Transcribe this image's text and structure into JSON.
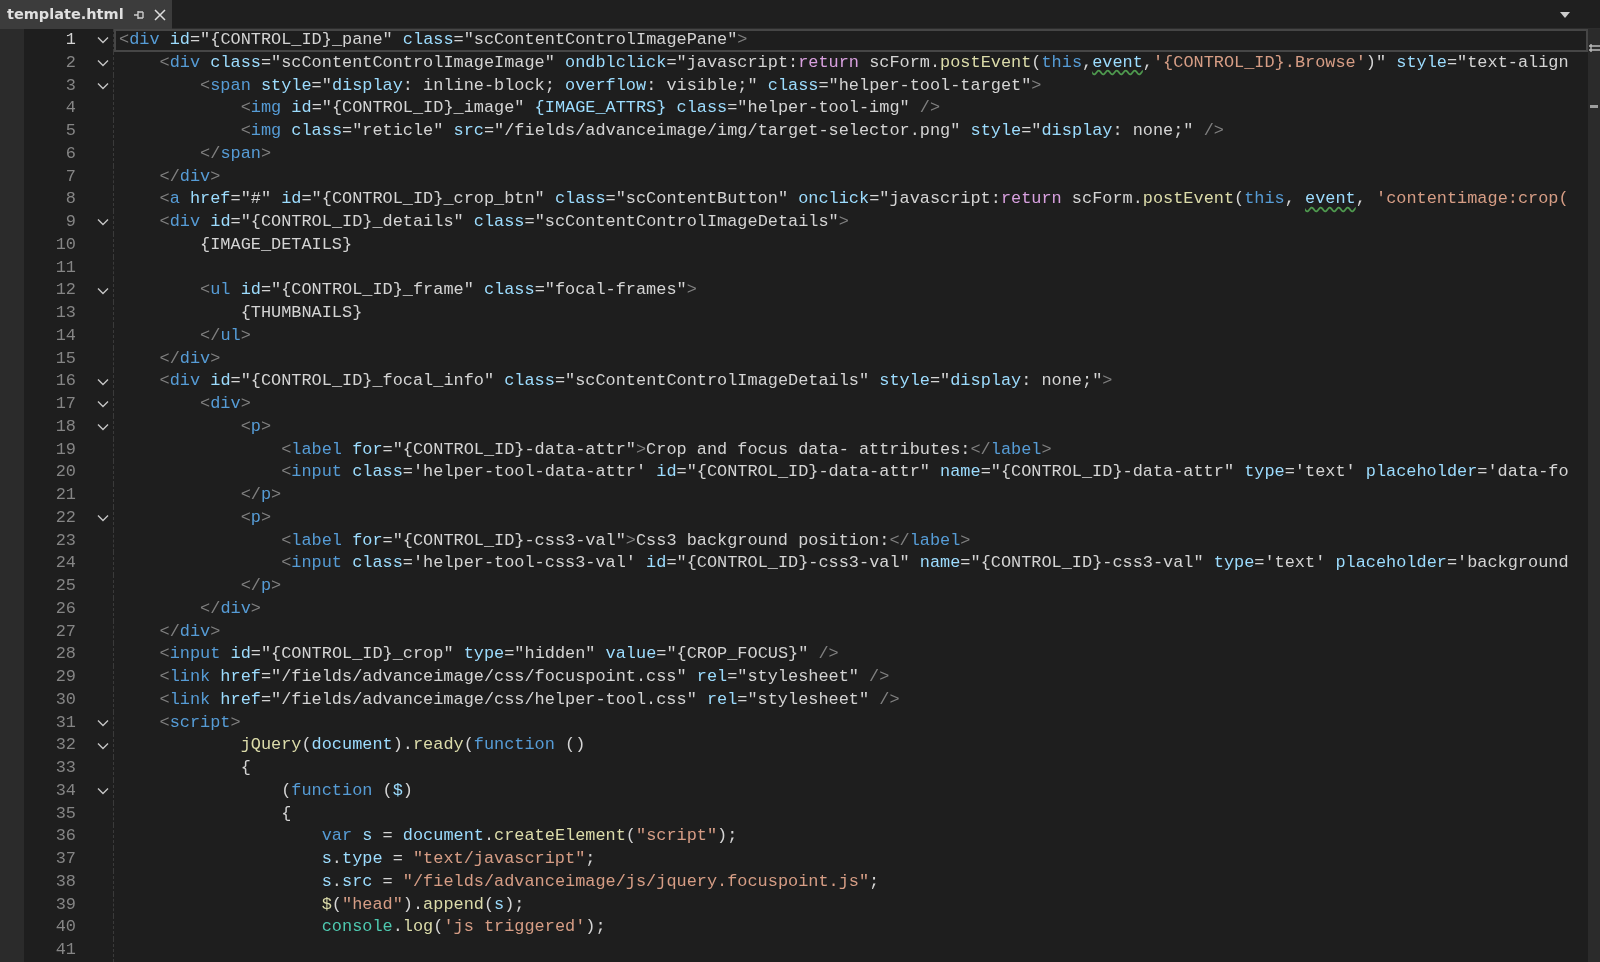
{
  "tabs": [
    {
      "title": "template.html",
      "selected": true
    }
  ],
  "lines": [
    {
      "number": "1",
      "current": true,
      "foldable": true,
      "tokens": [
        {
          "kind": "punct",
          "text": "<"
        },
        {
          "kind": "tag",
          "text": "div"
        },
        {
          "kind": "attr",
          "text": " id"
        },
        {
          "kind": "text",
          "text": "=\"{CONTROL_ID}_pane\""
        },
        {
          "kind": "attr",
          "text": " class"
        },
        {
          "kind": "text",
          "text": "=\"scContentControlImagePane\""
        },
        {
          "kind": "punct",
          "text": ">"
        }
      ]
    },
    {
      "number": "2",
      "current": false,
      "foldable": true,
      "tokens": [
        {
          "kind": "punct",
          "text": "    <"
        },
        {
          "kind": "tag",
          "text": "div"
        },
        {
          "kind": "attr",
          "text": " class"
        },
        {
          "kind": "text",
          "text": "=\"scContentControlImageImage\""
        },
        {
          "kind": "attr",
          "text": " ondblclick"
        },
        {
          "kind": "text",
          "text": "=\"javascript:"
        },
        {
          "kind": "control",
          "text": "return"
        },
        {
          "kind": "text",
          "text": " scForm."
        },
        {
          "kind": "func",
          "text": "postEvent"
        },
        {
          "kind": "text",
          "text": "("
        },
        {
          "kind": "keyword",
          "text": "this"
        },
        {
          "kind": "text",
          "text": ","
        },
        {
          "kind": "warn",
          "text": "event"
        },
        {
          "kind": "text",
          "text": ","
        },
        {
          "kind": "string",
          "text": "'{CONTROL_ID}.Browse'"
        },
        {
          "kind": "text",
          "text": ")\""
        },
        {
          "kind": "attr",
          "text": " style"
        },
        {
          "kind": "text",
          "text": "=\"text-align"
        }
      ]
    },
    {
      "number": "3",
      "current": false,
      "foldable": true,
      "tokens": [
        {
          "kind": "punct",
          "text": "        <"
        },
        {
          "kind": "tag",
          "text": "span"
        },
        {
          "kind": "attr",
          "text": " style"
        },
        {
          "kind": "text",
          "text": "=\""
        },
        {
          "kind": "attr",
          "text": "display"
        },
        {
          "kind": "text",
          "text": ": inline-block; "
        },
        {
          "kind": "attr",
          "text": "overflow"
        },
        {
          "kind": "text",
          "text": ": visible;\""
        },
        {
          "kind": "attr",
          "text": " class"
        },
        {
          "kind": "text",
          "text": "=\"helper-tool-target\""
        },
        {
          "kind": "punct",
          "text": ">"
        }
      ]
    },
    {
      "number": "4",
      "current": false,
      "foldable": false,
      "tokens": [
        {
          "kind": "punct",
          "text": "            <"
        },
        {
          "kind": "tag",
          "text": "img"
        },
        {
          "kind": "attr",
          "text": " id"
        },
        {
          "kind": "text",
          "text": "=\"{CONTROL_ID}_image\""
        },
        {
          "kind": "attr",
          "text": " {IMAGE_ATTRS}"
        },
        {
          "kind": "attr",
          "text": " class"
        },
        {
          "kind": "text",
          "text": "=\"helper-tool-img\""
        },
        {
          "kind": "punct",
          "text": " />"
        }
      ]
    },
    {
      "number": "5",
      "current": false,
      "foldable": false,
      "tokens": [
        {
          "kind": "punct",
          "text": "            <"
        },
        {
          "kind": "tag",
          "text": "img"
        },
        {
          "kind": "attr",
          "text": " class"
        },
        {
          "kind": "text",
          "text": "=\"reticle\""
        },
        {
          "kind": "attr",
          "text": " src"
        },
        {
          "kind": "text",
          "text": "=\"/fields/advanceimage/img/target-selector.png\""
        },
        {
          "kind": "attr",
          "text": " style"
        },
        {
          "kind": "text",
          "text": "=\""
        },
        {
          "kind": "attr",
          "text": "display"
        },
        {
          "kind": "text",
          "text": ": none;\""
        },
        {
          "kind": "punct",
          "text": " />"
        }
      ]
    },
    {
      "number": "6",
      "current": false,
      "foldable": false,
      "tokens": [
        {
          "kind": "punct",
          "text": "        </"
        },
        {
          "kind": "tag",
          "text": "span"
        },
        {
          "kind": "punct",
          "text": ">"
        }
      ]
    },
    {
      "number": "7",
      "current": false,
      "foldable": false,
      "tokens": [
        {
          "kind": "punct",
          "text": "    </"
        },
        {
          "kind": "tag",
          "text": "div"
        },
        {
          "kind": "punct",
          "text": ">"
        }
      ]
    },
    {
      "number": "8",
      "current": false,
      "foldable": false,
      "tokens": [
        {
          "kind": "punct",
          "text": "    <"
        },
        {
          "kind": "tag",
          "text": "a"
        },
        {
          "kind": "attr",
          "text": " href"
        },
        {
          "kind": "text",
          "text": "=\"#\""
        },
        {
          "kind": "attr",
          "text": " id"
        },
        {
          "kind": "text",
          "text": "=\"{CONTROL_ID}_crop_btn\""
        },
        {
          "kind": "attr",
          "text": " class"
        },
        {
          "kind": "text",
          "text": "=\"scContentButton\""
        },
        {
          "kind": "attr",
          "text": " onclick"
        },
        {
          "kind": "text",
          "text": "=\"javascript:"
        },
        {
          "kind": "control",
          "text": "return"
        },
        {
          "kind": "text",
          "text": " scForm."
        },
        {
          "kind": "func",
          "text": "postEvent"
        },
        {
          "kind": "text",
          "text": "("
        },
        {
          "kind": "keyword",
          "text": "this"
        },
        {
          "kind": "text",
          "text": ", "
        },
        {
          "kind": "warn",
          "text": "event"
        },
        {
          "kind": "text",
          "text": ", "
        },
        {
          "kind": "string",
          "text": "'contentimage:crop("
        }
      ]
    },
    {
      "number": "9",
      "current": false,
      "foldable": true,
      "tokens": [
        {
          "kind": "punct",
          "text": "    <"
        },
        {
          "kind": "tag",
          "text": "div"
        },
        {
          "kind": "attr",
          "text": " id"
        },
        {
          "kind": "text",
          "text": "=\"{CONTROL_ID}_details\""
        },
        {
          "kind": "attr",
          "text": " class"
        },
        {
          "kind": "text",
          "text": "=\"scContentControlImageDetails\""
        },
        {
          "kind": "punct",
          "text": ">"
        }
      ]
    },
    {
      "number": "10",
      "current": false,
      "foldable": false,
      "tokens": [
        {
          "kind": "text",
          "text": "        {IMAGE_DETAILS}"
        }
      ]
    },
    {
      "number": "11",
      "current": false,
      "foldable": false
    },
    {
      "number": "12",
      "current": false,
      "foldable": true,
      "tokens": [
        {
          "kind": "punct",
          "text": "        <"
        },
        {
          "kind": "tag",
          "text": "ul"
        },
        {
          "kind": "attr",
          "text": " id"
        },
        {
          "kind": "text",
          "text": "=\"{CONTROL_ID}_frame\""
        },
        {
          "kind": "attr",
          "text": " class"
        },
        {
          "kind": "text",
          "text": "=\"focal-frames\""
        },
        {
          "kind": "punct",
          "text": ">"
        }
      ]
    },
    {
      "number": "13",
      "current": false,
      "foldable": false,
      "tokens": [
        {
          "kind": "text",
          "text": "            {THUMBNAILS}"
        }
      ]
    },
    {
      "number": "14",
      "current": false,
      "foldable": false,
      "tokens": [
        {
          "kind": "punct",
          "text": "        </"
        },
        {
          "kind": "tag",
          "text": "ul"
        },
        {
          "kind": "punct",
          "text": ">"
        }
      ]
    },
    {
      "number": "15",
      "current": false,
      "foldable": false,
      "tokens": [
        {
          "kind": "punct",
          "text": "    </"
        },
        {
          "kind": "tag",
          "text": "div"
        },
        {
          "kind": "punct",
          "text": ">"
        }
      ]
    },
    {
      "number": "16",
      "current": false,
      "foldable": true,
      "tokens": [
        {
          "kind": "punct",
          "text": "    <"
        },
        {
          "kind": "tag",
          "text": "div"
        },
        {
          "kind": "attr",
          "text": " id"
        },
        {
          "kind": "text",
          "text": "=\"{CONTROL_ID}_focal_info\""
        },
        {
          "kind": "attr",
          "text": " class"
        },
        {
          "kind": "text",
          "text": "=\"scContentControlImageDetails\""
        },
        {
          "kind": "attr",
          "text": " style"
        },
        {
          "kind": "text",
          "text": "=\""
        },
        {
          "kind": "attr",
          "text": "display"
        },
        {
          "kind": "text",
          "text": ": none;\""
        },
        {
          "kind": "punct",
          "text": ">"
        }
      ]
    },
    {
      "number": "17",
      "current": false,
      "foldable": true,
      "tokens": [
        {
          "kind": "punct",
          "text": "        <"
        },
        {
          "kind": "tag",
          "text": "div"
        },
        {
          "kind": "punct",
          "text": ">"
        }
      ]
    },
    {
      "number": "18",
      "current": false,
      "foldable": true,
      "tokens": [
        {
          "kind": "punct",
          "text": "            <"
        },
        {
          "kind": "tag",
          "text": "p"
        },
        {
          "kind": "punct",
          "text": ">"
        }
      ]
    },
    {
      "number": "19",
      "current": false,
      "foldable": false,
      "tokens": [
        {
          "kind": "punct",
          "text": "                <"
        },
        {
          "kind": "tag",
          "text": "label"
        },
        {
          "kind": "attr",
          "text": " for"
        },
        {
          "kind": "text",
          "text": "=\"{CONTROL_ID}-data-attr\""
        },
        {
          "kind": "punct",
          "text": ">"
        },
        {
          "kind": "text",
          "text": "Crop and focus data- attributes:"
        },
        {
          "kind": "punct",
          "text": "</"
        },
        {
          "kind": "tag",
          "text": "label"
        },
        {
          "kind": "punct",
          "text": ">"
        }
      ]
    },
    {
      "number": "20",
      "current": false,
      "foldable": false,
      "tokens": [
        {
          "kind": "punct",
          "text": "                <"
        },
        {
          "kind": "tag",
          "text": "input"
        },
        {
          "kind": "attr",
          "text": " class"
        },
        {
          "kind": "text",
          "text": "='helper-tool-data-attr'"
        },
        {
          "kind": "attr",
          "text": " id"
        },
        {
          "kind": "text",
          "text": "=\"{CONTROL_ID}-data-attr\""
        },
        {
          "kind": "attr",
          "text": " name"
        },
        {
          "kind": "text",
          "text": "=\"{CONTROL_ID}-data-attr\""
        },
        {
          "kind": "attr",
          "text": " type"
        },
        {
          "kind": "text",
          "text": "='text'"
        },
        {
          "kind": "attr",
          "text": " placeholder"
        },
        {
          "kind": "text",
          "text": "='data-fo"
        }
      ]
    },
    {
      "number": "21",
      "current": false,
      "foldable": false,
      "tokens": [
        {
          "kind": "punct",
          "text": "            </"
        },
        {
          "kind": "tag",
          "text": "p"
        },
        {
          "kind": "punct",
          "text": ">"
        }
      ]
    },
    {
      "number": "22",
      "current": false,
      "foldable": true,
      "tokens": [
        {
          "kind": "punct",
          "text": "            <"
        },
        {
          "kind": "tag",
          "text": "p"
        },
        {
          "kind": "punct",
          "text": ">"
        }
      ]
    },
    {
      "number": "23",
      "current": false,
      "foldable": false,
      "tokens": [
        {
          "kind": "punct",
          "text": "                <"
        },
        {
          "kind": "tag",
          "text": "label"
        },
        {
          "kind": "attr",
          "text": " for"
        },
        {
          "kind": "text",
          "text": "=\"{CONTROL_ID}-css3-val\""
        },
        {
          "kind": "punct",
          "text": ">"
        },
        {
          "kind": "text",
          "text": "Css3 background position:"
        },
        {
          "kind": "punct",
          "text": "</"
        },
        {
          "kind": "tag",
          "text": "label"
        },
        {
          "kind": "punct",
          "text": ">"
        }
      ]
    },
    {
      "number": "24",
      "current": false,
      "foldable": false,
      "tokens": [
        {
          "kind": "punct",
          "text": "                <"
        },
        {
          "kind": "tag",
          "text": "input"
        },
        {
          "kind": "attr",
          "text": " class"
        },
        {
          "kind": "text",
          "text": "='helper-tool-css3-val'"
        },
        {
          "kind": "attr",
          "text": " id"
        },
        {
          "kind": "text",
          "text": "=\"{CONTROL_ID}-css3-val\""
        },
        {
          "kind": "attr",
          "text": " name"
        },
        {
          "kind": "text",
          "text": "=\"{CONTROL_ID}-css3-val\""
        },
        {
          "kind": "attr",
          "text": " type"
        },
        {
          "kind": "text",
          "text": "='text'"
        },
        {
          "kind": "attr",
          "text": " placeholder"
        },
        {
          "kind": "text",
          "text": "='background"
        }
      ]
    },
    {
      "number": "25",
      "current": false,
      "foldable": false,
      "tokens": [
        {
          "kind": "punct",
          "text": "            </"
        },
        {
          "kind": "tag",
          "text": "p"
        },
        {
          "kind": "punct",
          "text": ">"
        }
      ]
    },
    {
      "number": "26",
      "current": false,
      "foldable": false,
      "tokens": [
        {
          "kind": "punct",
          "text": "        </"
        },
        {
          "kind": "tag",
          "text": "div"
        },
        {
          "kind": "punct",
          "text": ">"
        }
      ]
    },
    {
      "number": "27",
      "current": false,
      "foldable": false,
      "tokens": [
        {
          "kind": "punct",
          "text": "    </"
        },
        {
          "kind": "tag",
          "text": "div"
        },
        {
          "kind": "punct",
          "text": ">"
        }
      ]
    },
    {
      "number": "28",
      "current": false,
      "foldable": false,
      "tokens": [
        {
          "kind": "punct",
          "text": "    <"
        },
        {
          "kind": "tag",
          "text": "input"
        },
        {
          "kind": "attr",
          "text": " id"
        },
        {
          "kind": "text",
          "text": "=\"{CONTROL_ID}_crop\""
        },
        {
          "kind": "attr",
          "text": " type"
        },
        {
          "kind": "text",
          "text": "=\"hidden\""
        },
        {
          "kind": "attr",
          "text": " value"
        },
        {
          "kind": "text",
          "text": "=\"{CROP_FOCUS}\""
        },
        {
          "kind": "punct",
          "text": " />"
        }
      ]
    },
    {
      "number": "29",
      "current": false,
      "foldable": false,
      "tokens": [
        {
          "kind": "punct",
          "text": "    <"
        },
        {
          "kind": "tag",
          "text": "link"
        },
        {
          "kind": "attr",
          "text": " href"
        },
        {
          "kind": "text",
          "text": "=\"/fields/advanceimage/css/focuspoint.css\""
        },
        {
          "kind": "attr",
          "text": " rel"
        },
        {
          "kind": "text",
          "text": "=\"stylesheet\""
        },
        {
          "kind": "punct",
          "text": " />"
        }
      ]
    },
    {
      "number": "30",
      "current": false,
      "foldable": false,
      "tokens": [
        {
          "kind": "punct",
          "text": "    <"
        },
        {
          "kind": "tag",
          "text": "link"
        },
        {
          "kind": "attr",
          "text": " href"
        },
        {
          "kind": "text",
          "text": "=\"/fields/advanceimage/css/helper-tool.css\""
        },
        {
          "kind": "attr",
          "text": " rel"
        },
        {
          "kind": "text",
          "text": "=\"stylesheet\""
        },
        {
          "kind": "punct",
          "text": " />"
        }
      ]
    },
    {
      "number": "31",
      "current": false,
      "foldable": true,
      "tokens": [
        {
          "kind": "punct",
          "text": "    <"
        },
        {
          "kind": "tag",
          "text": "script"
        },
        {
          "kind": "punct",
          "text": ">"
        }
      ]
    },
    {
      "number": "32",
      "current": false,
      "foldable": true,
      "tokens": [
        {
          "kind": "func",
          "text": "            jQuery"
        },
        {
          "kind": "text",
          "text": "("
        },
        {
          "kind": "var",
          "text": "document"
        },
        {
          "kind": "text",
          "text": ")."
        },
        {
          "kind": "func",
          "text": "ready"
        },
        {
          "kind": "text",
          "text": "("
        },
        {
          "kind": "keyword",
          "text": "function"
        },
        {
          "kind": "text",
          "text": " ()"
        }
      ]
    },
    {
      "number": "33",
      "current": false,
      "foldable": false,
      "tokens": [
        {
          "kind": "text",
          "text": "            {"
        }
      ]
    },
    {
      "number": "34",
      "current": false,
      "foldable": true,
      "tokens": [
        {
          "kind": "text",
          "text": "                ("
        },
        {
          "kind": "keyword",
          "text": "function"
        },
        {
          "kind": "text",
          "text": " ("
        },
        {
          "kind": "var",
          "text": "$"
        },
        {
          "kind": "text",
          "text": ")"
        }
      ]
    },
    {
      "number": "35",
      "current": false,
      "foldable": false,
      "tokens": [
        {
          "kind": "text",
          "text": "                {"
        }
      ]
    },
    {
      "number": "36",
      "current": false,
      "foldable": false,
      "tokens": [
        {
          "kind": "keyword",
          "text": "                    var"
        },
        {
          "kind": "var",
          "text": " s"
        },
        {
          "kind": "text",
          "text": " = "
        },
        {
          "kind": "var",
          "text": "document"
        },
        {
          "kind": "text",
          "text": "."
        },
        {
          "kind": "func",
          "text": "createElement"
        },
        {
          "kind": "text",
          "text": "("
        },
        {
          "kind": "string",
          "text": "\"script\""
        },
        {
          "kind": "text",
          "text": ");"
        }
      ]
    },
    {
      "number": "37",
      "current": false,
      "foldable": false,
      "tokens": [
        {
          "kind": "var",
          "text": "                    s"
        },
        {
          "kind": "text",
          "text": "."
        },
        {
          "kind": "var",
          "text": "type"
        },
        {
          "kind": "text",
          "text": " = "
        },
        {
          "kind": "string",
          "text": "\"text/javascript\""
        },
        {
          "kind": "text",
          "text": ";"
        }
      ]
    },
    {
      "number": "38",
      "current": false,
      "foldable": false,
      "tokens": [
        {
          "kind": "var",
          "text": "                    s"
        },
        {
          "kind": "text",
          "text": "."
        },
        {
          "kind": "var",
          "text": "src"
        },
        {
          "kind": "text",
          "text": " = "
        },
        {
          "kind": "string",
          "text": "\"/fields/advanceimage/js/jquery.focuspoint.js\""
        },
        {
          "kind": "text",
          "text": ";"
        }
      ]
    },
    {
      "number": "39",
      "current": false,
      "foldable": false,
      "tokens": [
        {
          "kind": "func",
          "text": "                    $"
        },
        {
          "kind": "text",
          "text": "("
        },
        {
          "kind": "string",
          "text": "\"head\""
        },
        {
          "kind": "text",
          "text": ")."
        },
        {
          "kind": "func",
          "text": "append"
        },
        {
          "kind": "text",
          "text": "("
        },
        {
          "kind": "var",
          "text": "s"
        },
        {
          "kind": "text",
          "text": ");"
        }
      ]
    },
    {
      "number": "40",
      "current": false,
      "foldable": false,
      "tokens": [
        {
          "kind": "type",
          "text": "                    console"
        },
        {
          "kind": "text",
          "text": "."
        },
        {
          "kind": "func",
          "text": "log"
        },
        {
          "kind": "text",
          "text": "("
        },
        {
          "kind": "string",
          "text": "'js triggered'"
        },
        {
          "kind": "text",
          "text": ");"
        }
      ]
    },
    {
      "number": "41",
      "current": false,
      "foldable": false
    }
  ]
}
